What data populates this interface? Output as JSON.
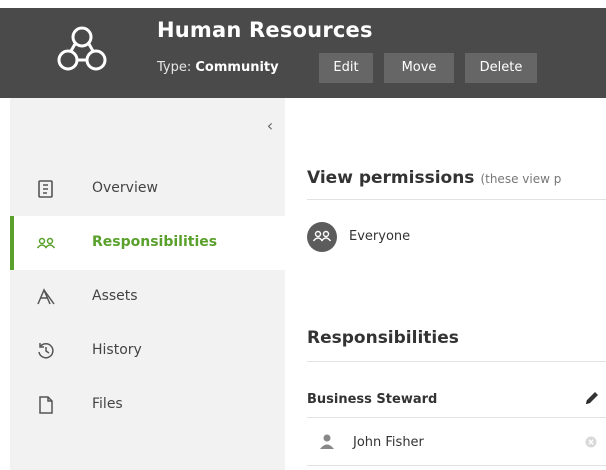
{
  "header": {
    "title": "Human Resources",
    "type_label": "Type:",
    "type_value": "Community",
    "buttons": {
      "edit": "Edit",
      "move": "Move",
      "delete": "Delete"
    }
  },
  "sidebar": {
    "collapse_glyph": "‹",
    "items": [
      {
        "label": "Overview",
        "icon": "overview-icon"
      },
      {
        "label": "Responsibilities",
        "icon": "people-icon",
        "active": true
      },
      {
        "label": "Assets",
        "icon": "assets-icon"
      },
      {
        "label": "History",
        "icon": "history-icon"
      },
      {
        "label": "Files",
        "icon": "file-icon"
      }
    ]
  },
  "main": {
    "view_permissions": {
      "title": "View permissions",
      "hint": "(these view p",
      "entry": "Everyone"
    },
    "responsibilities": {
      "title": "Responsibilities",
      "role": "Business Steward",
      "user": "John Fisher"
    }
  },
  "colors": {
    "header_bg": "#4a4a4a",
    "button_bg": "#666666",
    "sidebar_bg": "#f2f2f2",
    "accent": "#5aa02c"
  }
}
